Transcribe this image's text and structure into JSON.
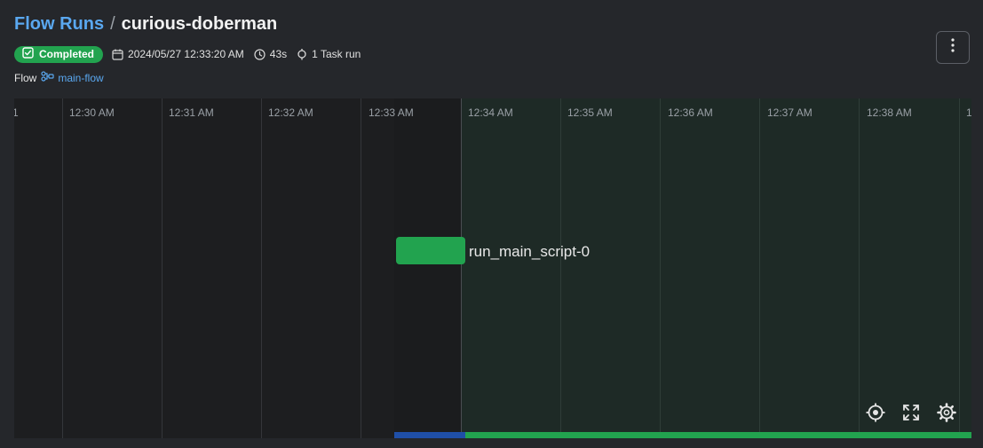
{
  "breadcrumb": {
    "parent": "Flow Runs",
    "separator": "/",
    "current": "curious-doberman"
  },
  "status": {
    "label": "Completed",
    "color": "#22a34f",
    "icon": "check-square-icon"
  },
  "meta": {
    "start_time": "2024/05/27 12:33:20 AM",
    "duration": "43s",
    "task_runs": "1 Task run"
  },
  "flow": {
    "label": "Flow",
    "name": "main-flow",
    "icon": "flow-icon"
  },
  "menu": {
    "icon": "more-vertical-icon"
  },
  "timeline": {
    "edge_label": "1",
    "ticks": [
      "12:30 AM",
      "12:31 AM",
      "12:32 AM",
      "12:33 AM",
      "12:34 AM",
      "12:35 AM",
      "12:36 AM",
      "12:37 AM",
      "12:38 AM"
    ],
    "end_label": "1",
    "task": {
      "name": "run_main_script-0",
      "state_color": "#22a34f"
    },
    "controls": [
      "recenter-icon",
      "fullscreen-icon",
      "settings-gear-icon"
    ]
  }
}
